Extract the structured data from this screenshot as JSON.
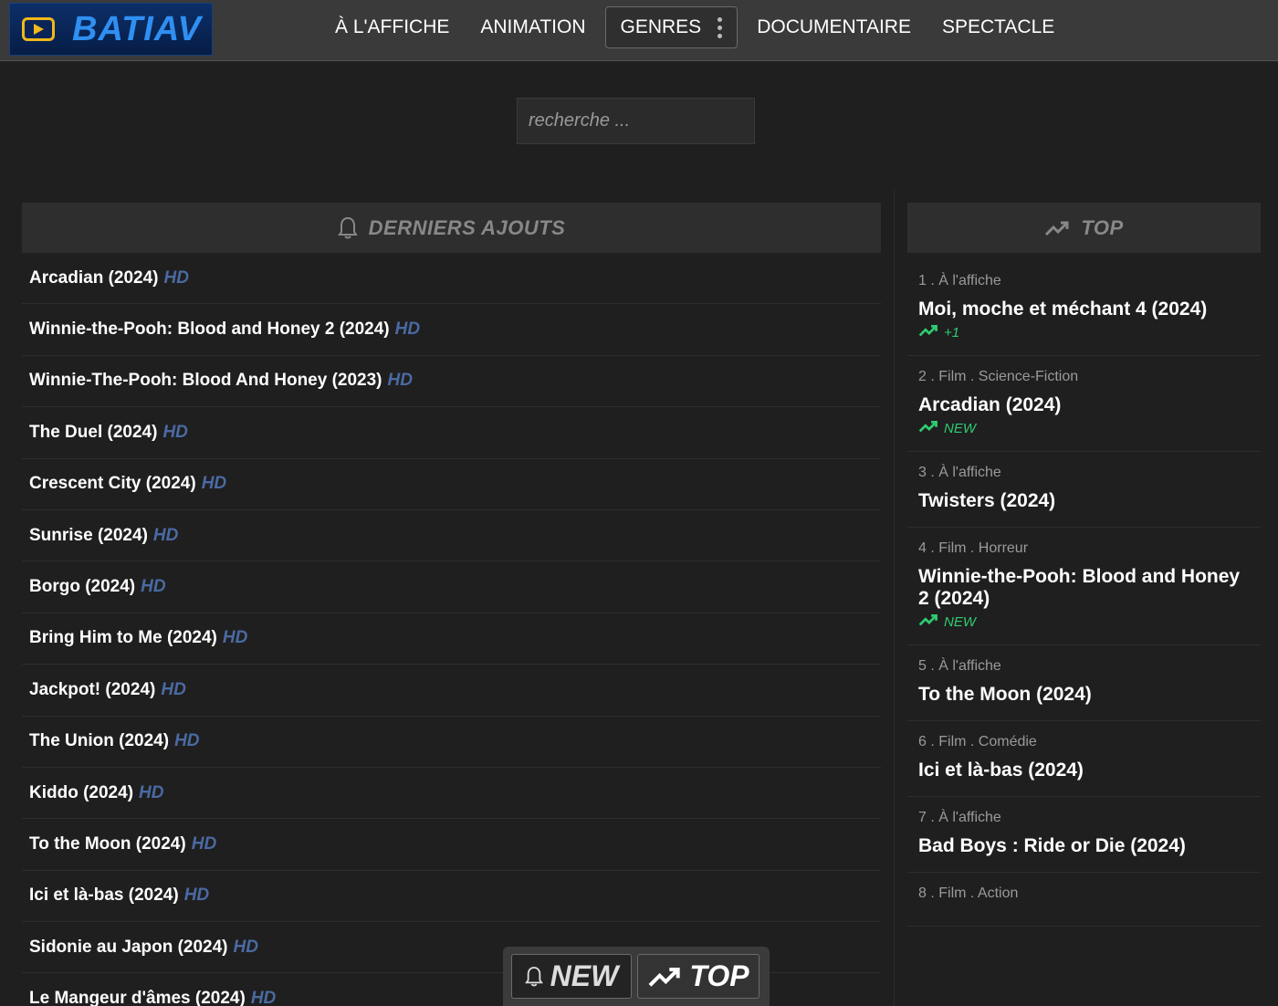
{
  "header": {
    "logo_text": "BATIAV",
    "nav": [
      {
        "label": "À L'AFFICHE"
      },
      {
        "label": "ANIMATION"
      },
      {
        "label": "GENRES"
      },
      {
        "label": "DOCUMENTAIRE"
      },
      {
        "label": "SPECTACLE"
      }
    ]
  },
  "search": {
    "placeholder": "recherche ..."
  },
  "latest": {
    "heading": "DERNIERS AJOUTS",
    "badge": "HD",
    "items": [
      {
        "title": "Arcadian (2024)"
      },
      {
        "title": "Winnie-the-Pooh: Blood and Honey 2 (2024)"
      },
      {
        "title": "Winnie-The-Pooh: Blood And Honey (2023)"
      },
      {
        "title": "The Duel (2024)"
      },
      {
        "title": "Crescent City (2024)"
      },
      {
        "title": "Sunrise (2024)"
      },
      {
        "title": "Borgo (2024)"
      },
      {
        "title": "Bring Him to Me (2024)"
      },
      {
        "title": "Jackpot! (2024)"
      },
      {
        "title": "The Union (2024)"
      },
      {
        "title": "Kiddo (2024)"
      },
      {
        "title": "To the Moon (2024)"
      },
      {
        "title": "Ici et là-bas (2024)"
      },
      {
        "title": "Sidonie au Japon (2024)"
      },
      {
        "title": "Le Mangeur d'âmes (2024)"
      }
    ]
  },
  "top": {
    "heading": "TOP",
    "items": [
      {
        "meta": "1 . À l'affiche",
        "title": "Moi, moche et méchant 4 (2024)",
        "badge": "+1"
      },
      {
        "meta": "2 . Film . Science-Fiction",
        "title": "Arcadian (2024)",
        "badge": "NEW"
      },
      {
        "meta": "3 . À l'affiche",
        "title": "Twisters (2024)",
        "badge": ""
      },
      {
        "meta": "4 . Film . Horreur",
        "title": "Winnie-the-Pooh: Blood and Honey 2 (2024)",
        "badge": "NEW"
      },
      {
        "meta": "5 . À l'affiche",
        "title": "To the Moon (2024)",
        "badge": ""
      },
      {
        "meta": "6 . Film . Comédie",
        "title": "Ici et là-bas (2024)",
        "badge": ""
      },
      {
        "meta": "7 . À l'affiche",
        "title": "Bad Boys : Ride or Die (2024)",
        "badge": ""
      },
      {
        "meta": "8 . Film . Action",
        "title": "",
        "badge": ""
      }
    ]
  },
  "floating": {
    "new_label": "NEW",
    "top_label": "TOP"
  },
  "colors": {
    "accent": "#2f8ff2",
    "hd": "#4a6aa3",
    "trend": "#2ecc71",
    "logo_bg": "#0c2f68"
  }
}
